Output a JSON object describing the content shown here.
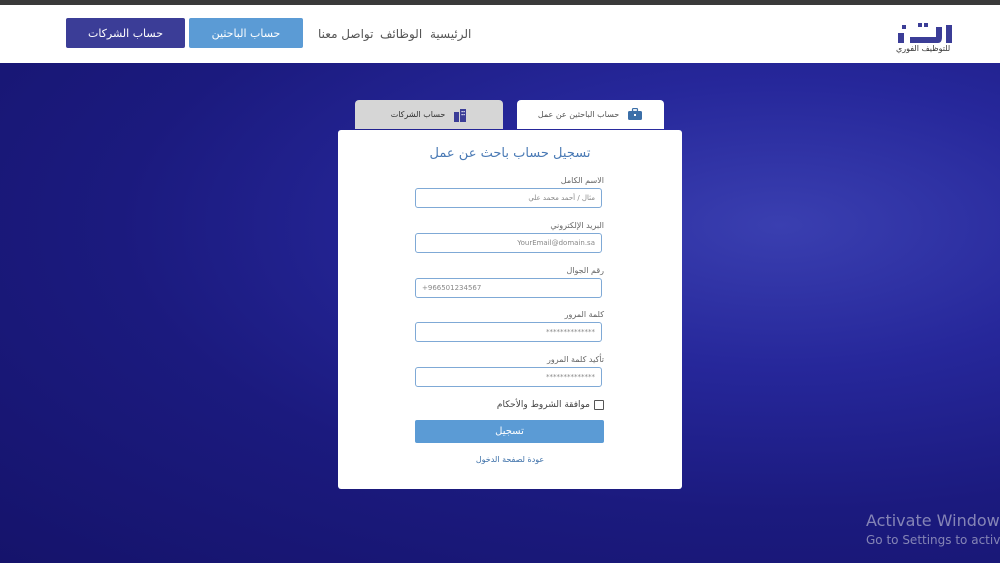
{
  "navbar": {
    "btn_companies": "حساب الشركات",
    "btn_seekers": "حساب الباحثين",
    "link_contact": "تواصل معنا",
    "link_jobs": "الوظائف",
    "link_home": "الرئيسية",
    "logo_text": "ذات",
    "logo_sub": "للتوظيف الفوري",
    "logo_icon": "logo-icon"
  },
  "tabs": {
    "companies": "حساب الشركات",
    "seekers": "حساب الباحثين عن عمل",
    "companies_icon": "building-icon",
    "seekers_icon": "briefcase-icon"
  },
  "form": {
    "title": "تسجيل حساب باحث عن عمل",
    "full_name_label": "الاسم الكامل",
    "full_name_placeholder": "مثال / أحمد محمد علي",
    "email_label": "البريد الإلكتروني",
    "email_placeholder": "YourEmail@domain.sa",
    "phone_label": "رقم الجوال",
    "phone_placeholder": "+966501234567",
    "password_label": "كلمة المرور",
    "password_placeholder": "**************",
    "confirm_label": "تأكيد كلمة المرور",
    "confirm_placeholder": "**************",
    "terms_label": "موافقة الشروط والأحكام",
    "submit_label": "تسجيل",
    "back_link": "عودة لصفحة الدخول"
  },
  "watermark": {
    "line1": "Activate Window",
    "line2": "Go to Settings to activ"
  },
  "colors": {
    "primary_dark": "#3b3d97",
    "primary_light": "#5b9bd5",
    "background": "#1b1a7e"
  }
}
